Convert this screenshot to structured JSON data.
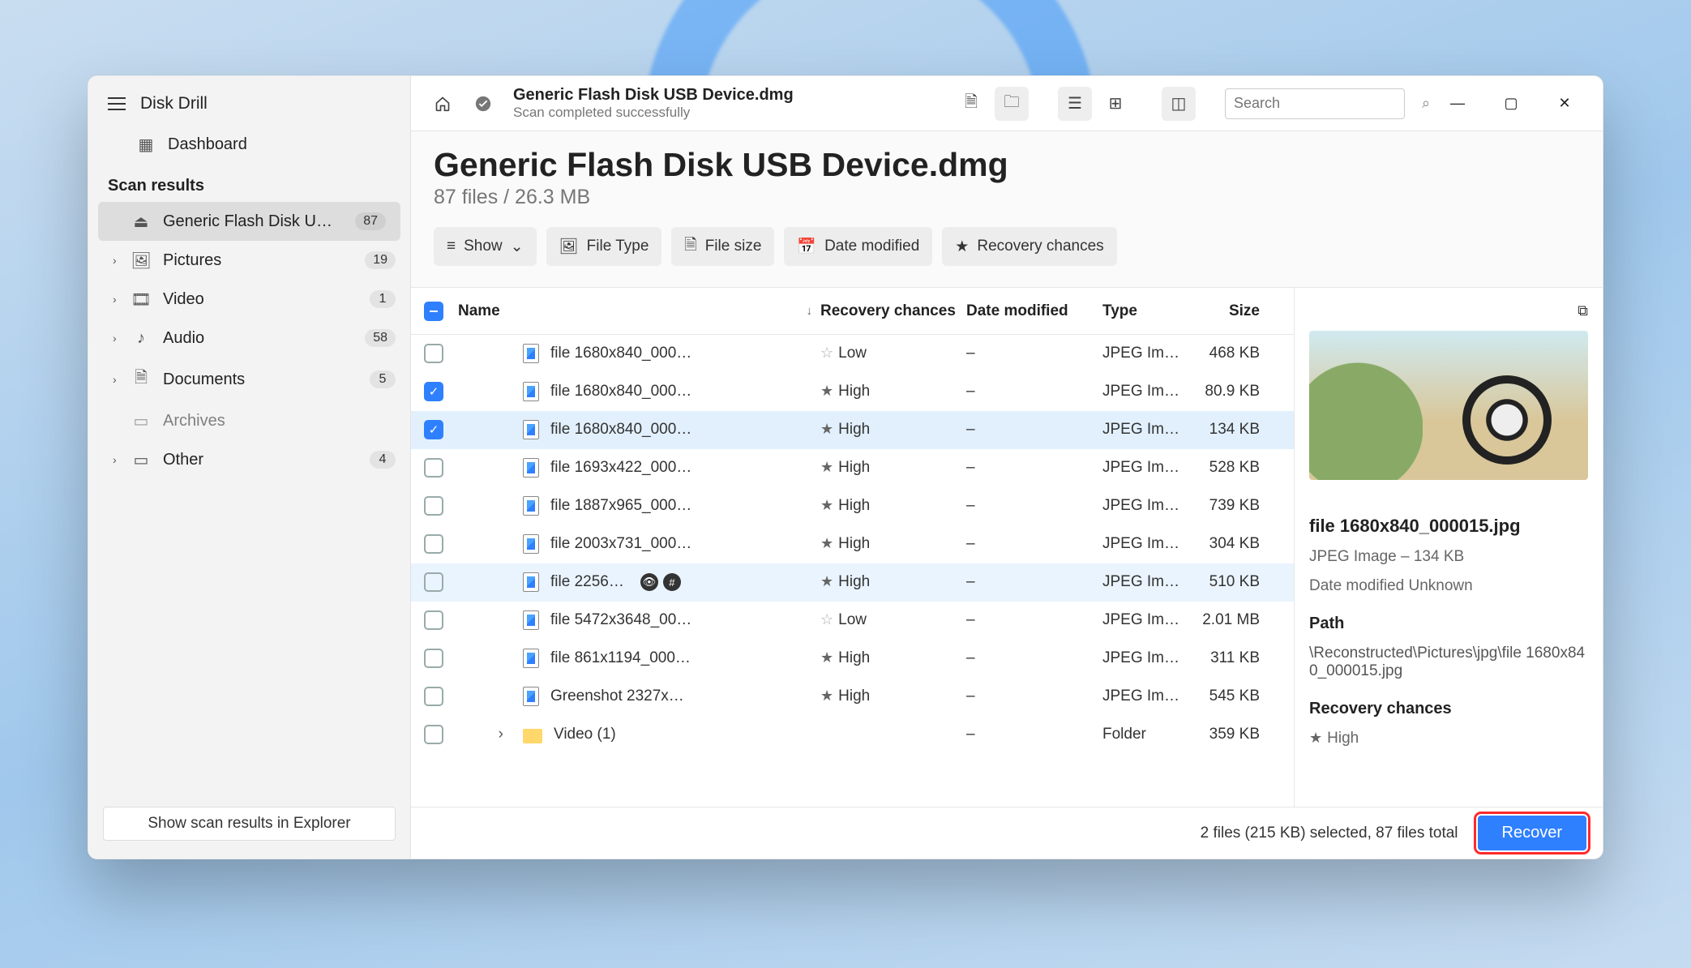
{
  "app": {
    "title": "Disk Drill"
  },
  "sidebar": {
    "dashboard": "Dashboard",
    "section": "Scan results",
    "items": [
      {
        "label": "Generic Flash Disk USB D…",
        "badge": "87",
        "icon": "drive",
        "active": true,
        "chev": false
      },
      {
        "label": "Pictures",
        "badge": "19",
        "icon": "picture",
        "chev": true
      },
      {
        "label": "Video",
        "badge": "1",
        "icon": "video",
        "chev": true
      },
      {
        "label": "Audio",
        "badge": "58",
        "icon": "audio",
        "chev": true
      },
      {
        "label": "Documents",
        "badge": "5",
        "icon": "document",
        "chev": true
      },
      {
        "label": "Archives",
        "badge": "",
        "icon": "archive",
        "chev": false,
        "disabled": true
      },
      {
        "label": "Other",
        "badge": "4",
        "icon": "other",
        "chev": true
      }
    ],
    "footer_button": "Show scan results in Explorer"
  },
  "topbar": {
    "title": "Generic Flash Disk USB Device.dmg",
    "subtitle": "Scan completed successfully",
    "search_placeholder": "Search"
  },
  "page": {
    "title": "Generic Flash Disk USB Device.dmg",
    "subtitle": "87 files / 26.3 MB",
    "filters": {
      "show": "Show",
      "file_type": "File Type",
      "file_size": "File size",
      "date_modified": "Date modified",
      "recovery_chances": "Recovery chances"
    }
  },
  "columns": {
    "name": "Name",
    "recovery": "Recovery chances",
    "date": "Date modified",
    "type": "Type",
    "size": "Size"
  },
  "rows": [
    {
      "name": "file 1680x840_000…",
      "rec": "Low",
      "date": "–",
      "type": "JPEG Im…",
      "size": "468 KB",
      "checked": false
    },
    {
      "name": "file 1680x840_000…",
      "rec": "High",
      "date": "–",
      "type": "JPEG Im…",
      "size": "80.9 KB",
      "checked": true
    },
    {
      "name": "file 1680x840_000…",
      "rec": "High",
      "date": "–",
      "type": "JPEG Im…",
      "size": "134 KB",
      "checked": true,
      "selected": true
    },
    {
      "name": "file 1693x422_000…",
      "rec": "High",
      "date": "–",
      "type": "JPEG Im…",
      "size": "528 KB",
      "checked": false
    },
    {
      "name": "file 1887x965_000…",
      "rec": "High",
      "date": "–",
      "type": "JPEG Im…",
      "size": "739 KB",
      "checked": false
    },
    {
      "name": "file 2003x731_000…",
      "rec": "High",
      "date": "–",
      "type": "JPEG Im…",
      "size": "304 KB",
      "checked": false
    },
    {
      "name": "file 2256…",
      "rec": "High",
      "date": "–",
      "type": "JPEG Im…",
      "size": "510 KB",
      "checked": false,
      "hover": true,
      "badges": true
    },
    {
      "name": "file 5472x3648_00…",
      "rec": "Low",
      "date": "–",
      "type": "JPEG Im…",
      "size": "2.01 MB",
      "checked": false
    },
    {
      "name": "file 861x1194_000…",
      "rec": "High",
      "date": "–",
      "type": "JPEG Im…",
      "size": "311 KB",
      "checked": false
    },
    {
      "name": "Greenshot 2327x…",
      "rec": "High",
      "date": "–",
      "type": "JPEG Im…",
      "size": "545 KB",
      "checked": false
    },
    {
      "name": "Video (1)",
      "rec": "",
      "date": "–",
      "type": "Folder",
      "size": "359 KB",
      "checked": false,
      "folder": true
    }
  ],
  "preview": {
    "filename": "file 1680x840_000015.jpg",
    "meta": "JPEG Image – 134 KB",
    "date": "Date modified Unknown",
    "path_label": "Path",
    "path": "\\Reconstructed\\Pictures\\jpg\\file 1680x840_000015.jpg",
    "rec_label": "Recovery chances",
    "rec_value": "High"
  },
  "footer": {
    "status": "2 files (215 KB) selected, 87 files total",
    "recover": "Recover"
  }
}
